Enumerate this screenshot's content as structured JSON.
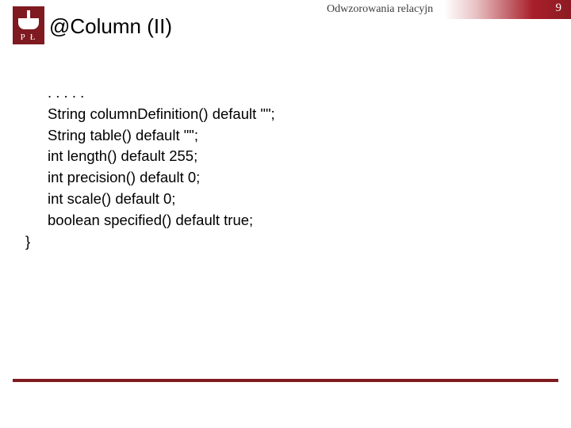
{
  "header": {
    "label": "Odwzorowania relacyjn",
    "page_number": "9"
  },
  "logo": {
    "letters": "P Ł"
  },
  "title": "@Column (II)",
  "code": {
    "lines": [
      ". . . . .",
      "String columnDefinition() default \"\";",
      "String table() default \"\";",
      "int length() default 255;",
      "int precision() default 0;",
      "int scale() default 0;",
      "boolean specified() default true;"
    ],
    "close": "}"
  },
  "colors": {
    "brand": "#7f1a20"
  }
}
